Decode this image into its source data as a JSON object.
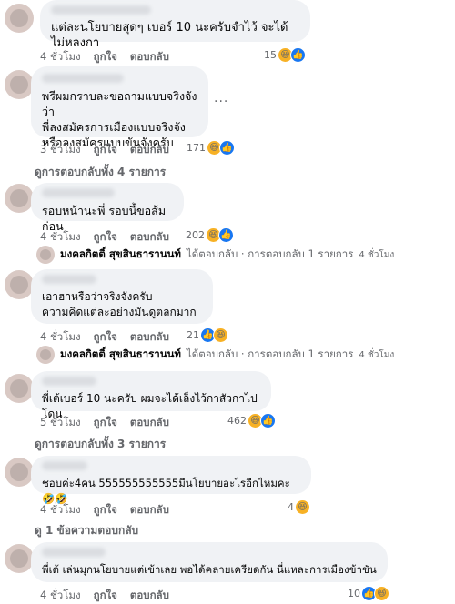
{
  "comments": [
    {
      "text": "แต่ละนโยบายสุดๆ เบอร์ 10 นะครับจำไว้ จะได้ ไม่หลงกา",
      "time": "4 ชั่วโมง",
      "like": "ถูกใจ",
      "reply": "ตอบกลับ",
      "count": "15",
      "reactions": [
        "haha",
        "like"
      ]
    },
    {
      "text": "พรีผมกราบละขอถามแบบจริงจังว่า\nพี่ลงสมัครการเมืองแบบจริงจัง\nหรือลงสมัครแบบขันจังครับ",
      "time": "3 ชั่วโมง",
      "like": "ถูกใจ",
      "reply": "ตอบกลับ",
      "count": "171",
      "reactions": [
        "haha",
        "like"
      ],
      "more_icon": "more-horizontal-icon"
    },
    {
      "text": "รอบหน้านะพี่ รอบนี้ขอส้มก่อน",
      "time": "4 ชั่วโมง",
      "like": "ถูกใจ",
      "reply": "ตอบกลับ",
      "count": "202",
      "reactions": [
        "haha",
        "like"
      ]
    },
    {
      "text": "เอาฮาหรือว่าจริงจังครับ\nความคิดแต่ละอย่างมันดูตลกมาก",
      "time": "4 ชั่วโมง",
      "like": "ถูกใจ",
      "reply": "ตอบกลับ",
      "count": "21",
      "reactions": [
        "like",
        "haha"
      ]
    },
    {
      "text": "พี่เต้เบอร์ 10 นะครับ ผมจะได้เล็งไว้กาสัวกาไปโดน",
      "time": "5 ชั่วโมง",
      "like": "ถูกใจ",
      "reply": "ตอบกลับ",
      "count": "462",
      "reactions": [
        "haha",
        "like"
      ]
    },
    {
      "text": "ชอบค่ะ4คน 555555555555มีนโยบายอะไรอีกไหมคะ🤣🤣",
      "time": "4 ชั่วโมง",
      "like": "ถูกใจ",
      "reply": "ตอบกลับ",
      "count": "4",
      "reactions": [
        "haha"
      ]
    },
    {
      "text": "พี่เต้ เล่นมุกนโยบายแต่เข้าเลย พอได้คลายเครียดกัน นี่แหละการเมืองข้าขัน",
      "time": "4 ชั่วโมง",
      "like": "ถูกใจ",
      "reply": "ตอบกลับ",
      "count": "10",
      "reactions": [
        "like",
        "haha"
      ]
    }
  ],
  "view_replies": [
    "ดูการตอบกลับทั้ง 4 รายการ",
    "ดูการตอบกลับทั้ง 3 รายการ",
    "ดู 1 ข้อความตอบกลับ"
  ],
  "reply_notices": [
    {
      "name": "มงคลกิตติ์ สุขสินธารานนท์",
      "action": "ได้ตอบกลับ · การตอบกลับ 1 รายการ",
      "time": "4 ชั่วโมง"
    },
    {
      "name": "มงคลกิตติ์ สุขสินธารานนท์",
      "action": "ได้ตอบกลับ · การตอบกลับ 1 รายการ",
      "time": "4 ชั่วโมง"
    }
  ],
  "colors": {
    "bubble": "#f0f2f5",
    "muted": "#65676b",
    "like_blue": "#1877f2",
    "haha_yellow": "#f7b125"
  }
}
